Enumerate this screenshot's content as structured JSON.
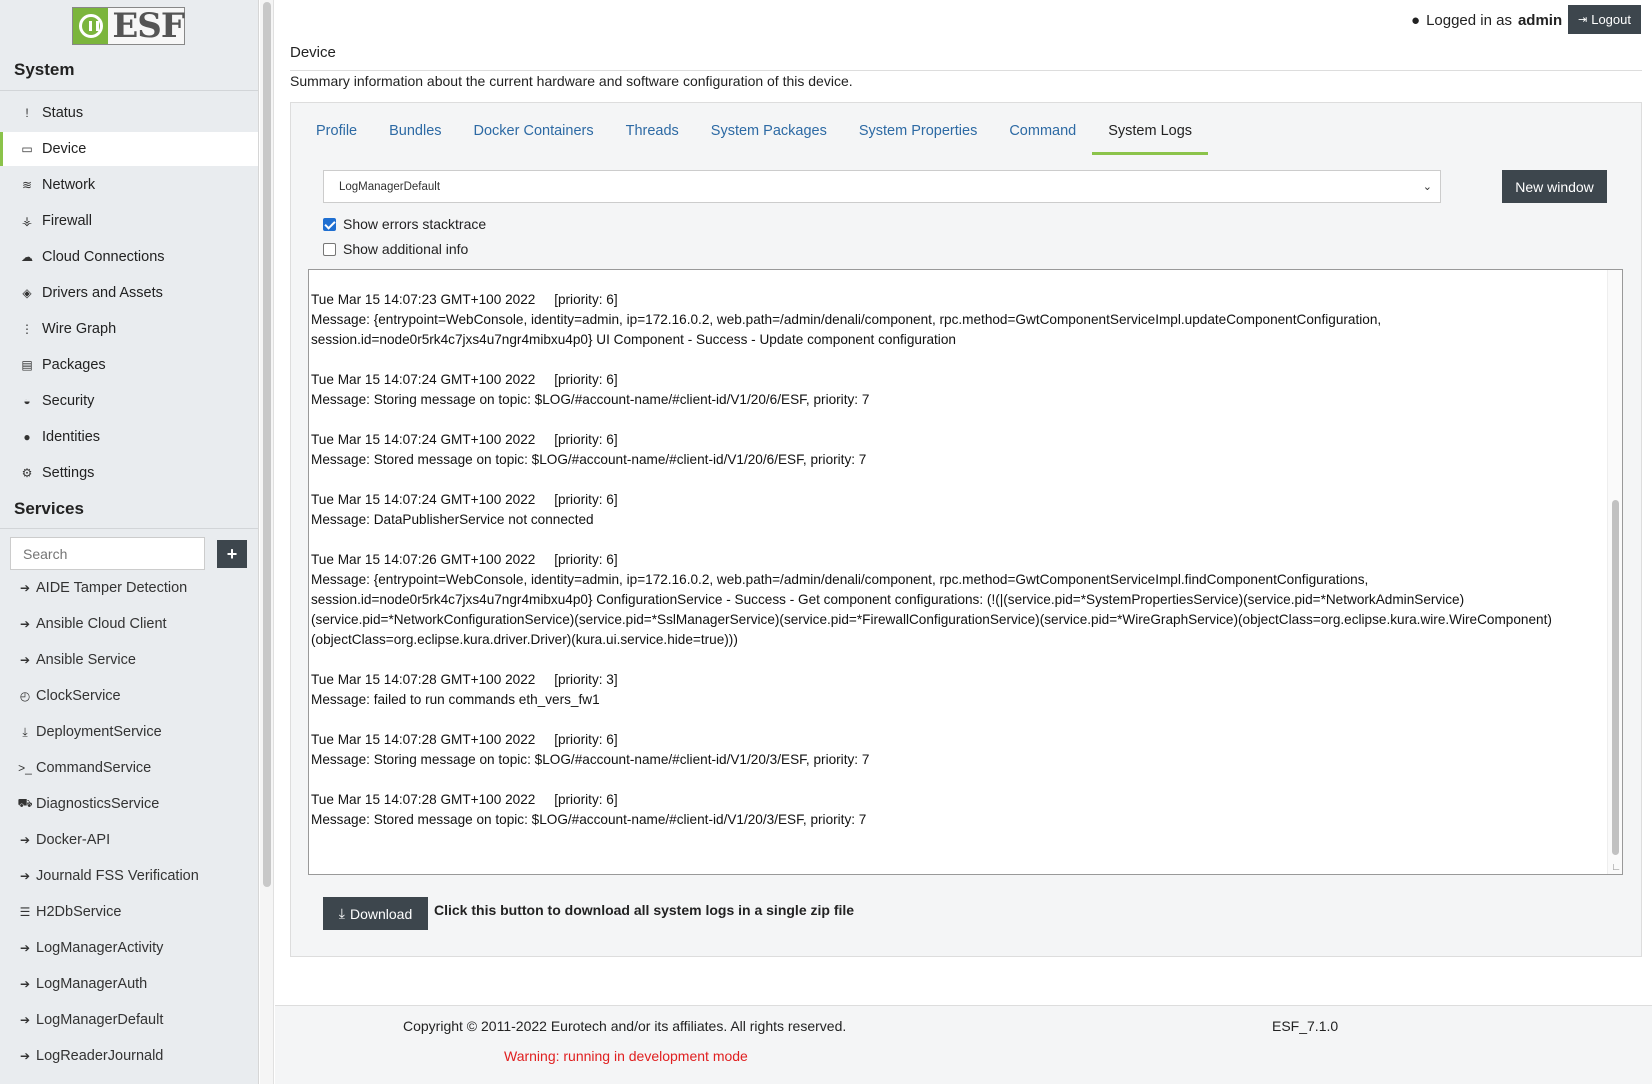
{
  "app": {
    "logo_text": "ESF",
    "brand_color": "#7bb53c",
    "accent_color": "#8bc34a",
    "button_color": "#3d464d"
  },
  "sidebar": {
    "system_title": "System",
    "system_items": [
      {
        "label": "Status",
        "icon": "exclamation-icon",
        "glyph": "!"
      },
      {
        "label": "Device",
        "icon": "hdd-icon",
        "glyph": "▭",
        "active": true
      },
      {
        "label": "Network",
        "icon": "wifi-icon",
        "glyph": "≋"
      },
      {
        "label": "Firewall",
        "icon": "fire-icon",
        "glyph": "⚶"
      },
      {
        "label": "Cloud Connections",
        "icon": "cloud-icon",
        "glyph": "☁"
      },
      {
        "label": "Drivers and Assets",
        "icon": "cube-icon",
        "glyph": "◈"
      },
      {
        "label": "Wire Graph",
        "icon": "sitemap-icon",
        "glyph": "⋮"
      },
      {
        "label": "Packages",
        "icon": "briefcase-icon",
        "glyph": "▤"
      },
      {
        "label": "Security",
        "icon": "shield-icon",
        "glyph": "◒"
      },
      {
        "label": "Identities",
        "icon": "user-icon",
        "glyph": "●"
      },
      {
        "label": "Settings",
        "icon": "gear-icon",
        "glyph": "⚙"
      }
    ],
    "services_title": "Services",
    "search_placeholder": "Search",
    "add_label": "+",
    "services": [
      {
        "label": "AIDE Tamper Detection",
        "icon": "chevron-circle-icon",
        "glyph": "➔"
      },
      {
        "label": "Ansible Cloud Client",
        "icon": "chevron-circle-icon",
        "glyph": "➔"
      },
      {
        "label": "Ansible Service",
        "icon": "chevron-circle-icon",
        "glyph": "➔"
      },
      {
        "label": "ClockService",
        "icon": "clock-icon",
        "glyph": "◴"
      },
      {
        "label": "DeploymentService",
        "icon": "download-icon",
        "glyph": "⤓"
      },
      {
        "label": "CommandService",
        "icon": "terminal-icon",
        "glyph": ">_"
      },
      {
        "label": "DiagnosticsService",
        "icon": "ambulance-icon",
        "glyph": "⛟"
      },
      {
        "label": "Docker-API",
        "icon": "chevron-circle-icon",
        "glyph": "➔"
      },
      {
        "label": "Journald FSS Verification",
        "icon": "chevron-circle-icon",
        "glyph": "➔"
      },
      {
        "label": "H2DbService",
        "icon": "database-icon",
        "glyph": "☰"
      },
      {
        "label": "LogManagerActivity",
        "icon": "chevron-circle-icon",
        "glyph": "➔"
      },
      {
        "label": "LogManagerAuth",
        "icon": "chevron-circle-icon",
        "glyph": "➔"
      },
      {
        "label": "LogManagerDefault",
        "icon": "chevron-circle-icon",
        "glyph": "➔"
      },
      {
        "label": "LogReaderJournald",
        "icon": "chevron-circle-icon",
        "glyph": "➔"
      }
    ]
  },
  "topbar": {
    "logged_in_label": "Logged in as",
    "username": "admin",
    "logout_label": "Logout"
  },
  "page": {
    "title": "Device",
    "description": "Summary information about the current hardware and software configuration of this device."
  },
  "tabs": [
    {
      "label": "Profile"
    },
    {
      "label": "Bundles"
    },
    {
      "label": "Docker Containers"
    },
    {
      "label": "Threads"
    },
    {
      "label": "System Packages"
    },
    {
      "label": "System Properties"
    },
    {
      "label": "Command"
    },
    {
      "label": "System Logs",
      "active": true
    }
  ],
  "logs": {
    "selected_source": "LogManagerDefault",
    "new_window_label": "New window",
    "show_stacktrace_label": "Show errors stacktrace",
    "show_stacktrace_checked": true,
    "show_additional_label": "Show additional info",
    "show_additional_checked": false,
    "entries": [
      {
        "header": "Tue Mar 15 14:07:23 GMT+100 2022     [priority: 6]",
        "lines": [
          "Message: {entrypoint=WebConsole, identity=admin, ip=172.16.0.2, web.path=/admin/denali/component, rpc.method=GwtComponentServiceImpl.updateComponentConfiguration,",
          "session.id=node0r5rk4c7jxs4u7ngr4mibxu4p0} UI Component - Success - Update component configuration"
        ]
      },
      {
        "header": "Tue Mar 15 14:07:24 GMT+100 2022     [priority: 6]",
        "lines": [
          "Message: Storing message on topic: $LOG/#account-name/#client-id/V1/20/6/ESF, priority: 7"
        ]
      },
      {
        "header": "Tue Mar 15 14:07:24 GMT+100 2022     [priority: 6]",
        "lines": [
          "Message: Stored message on topic: $LOG/#account-name/#client-id/V1/20/6/ESF, priority: 7"
        ]
      },
      {
        "header": "Tue Mar 15 14:07:24 GMT+100 2022     [priority: 6]",
        "lines": [
          "Message: DataPublisherService not connected"
        ]
      },
      {
        "header": "Tue Mar 15 14:07:26 GMT+100 2022     [priority: 6]",
        "lines": [
          "Message: {entrypoint=WebConsole, identity=admin, ip=172.16.0.2, web.path=/admin/denali/component, rpc.method=GwtComponentServiceImpl.findComponentConfigurations,",
          "session.id=node0r5rk4c7jxs4u7ngr4mibxu4p0} ConfigurationService - Success - Get component configurations: (!(|(service.pid=*SystemPropertiesService)(service.pid=*NetworkAdminService)",
          "(service.pid=*NetworkConfigurationService)(service.pid=*SslManagerService)(service.pid=*FirewallConfigurationService)(service.pid=*WireGraphService)(objectClass=org.eclipse.kura.wire.WireComponent)",
          "(objectClass=org.eclipse.kura.driver.Driver)(kura.ui.service.hide=true)))"
        ]
      },
      {
        "header": "Tue Mar 15 14:07:28 GMT+100 2022     [priority: 3]",
        "lines": [
          "Message: failed to run commands eth_vers_fw1"
        ]
      },
      {
        "header": "Tue Mar 15 14:07:28 GMT+100 2022     [priority: 6]",
        "lines": [
          "Message: Storing message on topic: $LOG/#account-name/#client-id/V1/20/3/ESF, priority: 7"
        ]
      },
      {
        "header": "Tue Mar 15 14:07:28 GMT+100 2022     [priority: 6]",
        "lines": [
          "Message: Stored message on topic: $LOG/#account-name/#client-id/V1/20/3/ESF, priority: 7"
        ]
      }
    ],
    "download_label": "Download",
    "download_hint": "Click this button to download all system logs in a single zip file"
  },
  "footer": {
    "copyright": "Copyright © 2011-2022 Eurotech and/or its affiliates. All rights reserved.",
    "version": "ESF_7.1.0",
    "warning": "Warning: running in development mode",
    "warning_color": "#e02020"
  }
}
